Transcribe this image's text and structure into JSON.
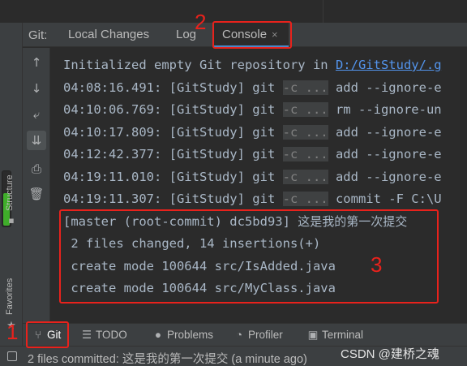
{
  "git_panel": {
    "label": "Git:",
    "tabs": [
      {
        "label": "Local Changes"
      },
      {
        "label": "Log"
      },
      {
        "label": "Console",
        "close": "×"
      }
    ]
  },
  "console": {
    "first_line": {
      "text": "Initialized empty Git repository in ",
      "link": "D:/GitStudy/.g"
    },
    "entries": [
      {
        "time": "04:08:16.491: [GitStudy] git ",
        "flag": "-c ...",
        "cmd": " add --ignore-e"
      },
      {
        "time": "04:10:06.769: [GitStudy] git ",
        "flag": "-c ...",
        "cmd": " rm --ignore-un"
      },
      {
        "time": "04:10:17.809: [GitStudy] git ",
        "flag": "-c ...",
        "cmd": " add --ignore-e"
      },
      {
        "time": "04:12:42.377: [GitStudy] git ",
        "flag": "-c ...",
        "cmd": " add --ignore-e"
      },
      {
        "time": "04:19:11.010: [GitStudy] git ",
        "flag": "-c ...",
        "cmd": " add --ignore-e"
      },
      {
        "time": "04:19:11.307: [GitStudy] git ",
        "flag": "-c ...",
        "cmd": " commit -F C:\\U"
      }
    ],
    "commit_output": {
      "header": "[master (root-commit) dc5bd93] ",
      "message": "这是我的第一次提交",
      "lines": [
        " 2 files changed, 14 insertions(+)",
        " create mode 100644 src/IsAdded.java",
        " create mode 100644 src/MyClass.java"
      ]
    }
  },
  "left_stripe": {
    "structure": "Structure",
    "favorites": "Favorites"
  },
  "bottom_tools": [
    {
      "label": "Git",
      "icon": "git-branch-icon"
    },
    {
      "label": "TODO",
      "icon": "list-icon"
    },
    {
      "label": "Problems",
      "icon": "info-icon"
    },
    {
      "label": "Profiler",
      "icon": "profiler-icon"
    },
    {
      "label": "Terminal",
      "icon": "terminal-icon"
    }
  ],
  "status": {
    "text": "2 files committed: 这是我的第一次提交 (a minute ago)"
  },
  "watermark": "CSDN @建桥之魂",
  "annotations": {
    "one": "1",
    "two": "2",
    "three": "3"
  },
  "colors": {
    "annotation_red": "#e8221c",
    "link_blue": "#5394ec",
    "progress_green": "#3fae2a"
  }
}
